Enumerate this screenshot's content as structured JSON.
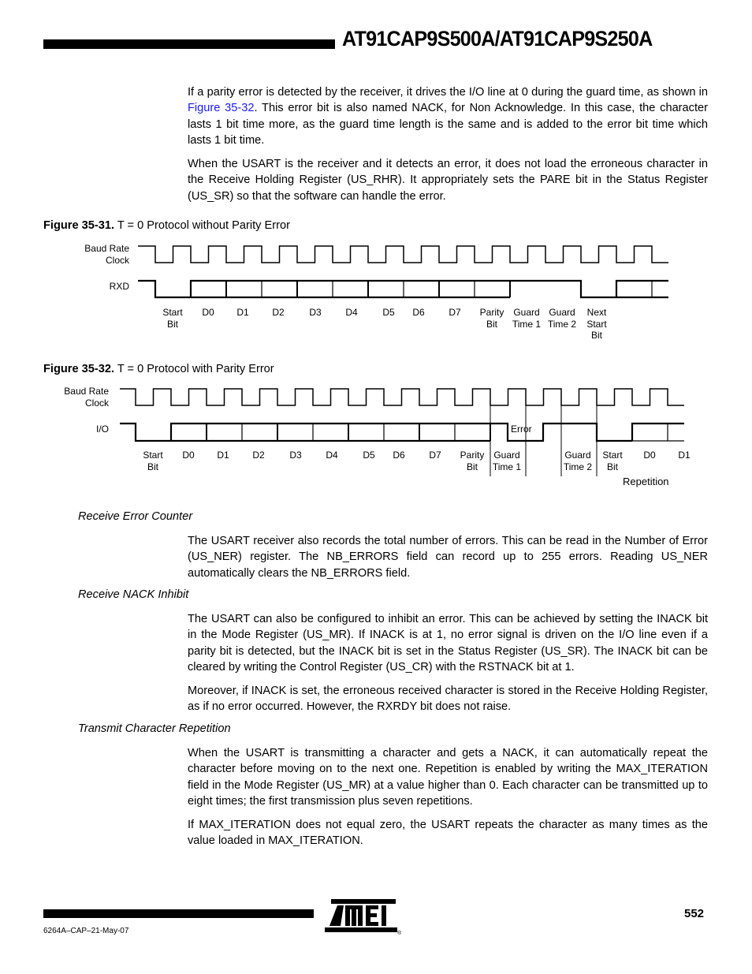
{
  "header": {
    "title": "AT91CAP9S500A/AT91CAP9S250A"
  },
  "intro": {
    "p1_before_link": "If a parity error is detected by the receiver, it drives the I/O line at 0 during the guard time, as shown in ",
    "p1_link": "Figure 35-32",
    "p1_after_link": ". This error bit is also named NACK, for Non Acknowledge. In this case, the character lasts 1 bit time more, as the guard time length is the same and is added to the error bit time which lasts 1 bit time.",
    "p2": "When the USART is the receiver and it detects an error, it does not load the erroneous character in the Receive Holding Register (US_RHR). It appropriately sets the PARE bit in the Status Register (US_SR) so that the software can handle the error."
  },
  "figure1": {
    "caption_bold": "Figure 35-31.",
    "caption_text": " T = 0 Protocol without Parity Error",
    "clock_label_line1": "Baud Rate",
    "clock_label_line2": "Clock",
    "data_label": "RXD",
    "bit_labels": [
      {
        "l1": "Start",
        "l2": "Bit",
        "l3": ""
      },
      {
        "l1": "D0",
        "l2": "",
        "l3": ""
      },
      {
        "l1": "D1",
        "l2": "",
        "l3": ""
      },
      {
        "l1": "D2",
        "l2": "",
        "l3": ""
      },
      {
        "l1": "D3",
        "l2": "",
        "l3": ""
      },
      {
        "l1": "D4",
        "l2": "",
        "l3": ""
      },
      {
        "l1": "D5",
        "l2": "",
        "l3": ""
      },
      {
        "l1": "D6",
        "l2": "",
        "l3": ""
      },
      {
        "l1": "D7",
        "l2": "",
        "l3": ""
      },
      {
        "l1": "Parity",
        "l2": "Bit",
        "l3": ""
      },
      {
        "l1": "Guard",
        "l2": "Time 1",
        "l3": ""
      },
      {
        "l1": "Guard",
        "l2": "Time 2",
        "l3": ""
      },
      {
        "l1": "Next",
        "l2": "Start",
        "l3": "Bit"
      }
    ]
  },
  "figure2": {
    "caption_bold": "Figure 35-32.",
    "caption_text": " T = 0 Protocol with Parity Error",
    "clock_label_line1": "Baud Rate",
    "clock_label_line2": "Clock",
    "data_label": "I/O",
    "error_label": "Error",
    "repetition_label": "Repetition",
    "bit_labels": [
      {
        "l1": "Start",
        "l2": "Bit"
      },
      {
        "l1": "D0",
        "l2": ""
      },
      {
        "l1": "D1",
        "l2": ""
      },
      {
        "l1": "D2",
        "l2": ""
      },
      {
        "l1": "D3",
        "l2": ""
      },
      {
        "l1": "D4",
        "l2": ""
      },
      {
        "l1": "D5",
        "l2": ""
      },
      {
        "l1": "D6",
        "l2": ""
      },
      {
        "l1": "D7",
        "l2": ""
      },
      {
        "l1": "Parity",
        "l2": "Bit"
      },
      {
        "l1": "Guard",
        "l2": "Time 1"
      },
      {
        "l1": "Guard",
        "l2": "Time 2"
      },
      {
        "l1": "Start",
        "l2": "Bit"
      },
      {
        "l1": "D0",
        "l2": ""
      },
      {
        "l1": "D1",
        "l2": ""
      }
    ]
  },
  "sections": [
    {
      "heading": "Receive Error Counter",
      "paragraphs": [
        "The USART receiver also records the total number of errors. This can be read in the Number of Error (US_NER) register. The NB_ERRORS field can record up to 255 errors. Reading US_NER automatically clears the NB_ERRORS field."
      ]
    },
    {
      "heading": "Receive NACK Inhibit",
      "paragraphs": [
        "The USART can also be configured to inhibit an error. This can be achieved by setting the INACK bit in the Mode Register (US_MR). If INACK is at 1, no error signal is driven on the I/O line even if a parity bit is detected, but the INACK bit is set in the Status Register (US_SR). The INACK bit can be cleared by writing the Control Register (US_CR) with the RSTNACK bit at 1.",
        "Moreover, if INACK is set, the erroneous received character is stored in the Receive Holding Register, as if no error occurred. However, the RXRDY bit does not raise."
      ]
    },
    {
      "heading": "Transmit Character Repetition",
      "paragraphs": [
        "When the USART is transmitting a character and gets a NACK, it can automatically repeat the character before moving on to the next one. Repetition is enabled by writing the MAX_ITERATION field in the Mode Register (US_MR) at a value higher than 0. Each character can be transmitted up to eight times; the first transmission plus seven repetitions.",
        "If MAX_ITERATION does not equal zero, the USART repeats the character as many times as the value loaded in MAX_ITERATION."
      ]
    }
  ],
  "footer": {
    "doc_number": "6264A–CAP–21-May-07",
    "page_number": "552",
    "logo_text": "ATMEL",
    "registered_mark": "®"
  }
}
